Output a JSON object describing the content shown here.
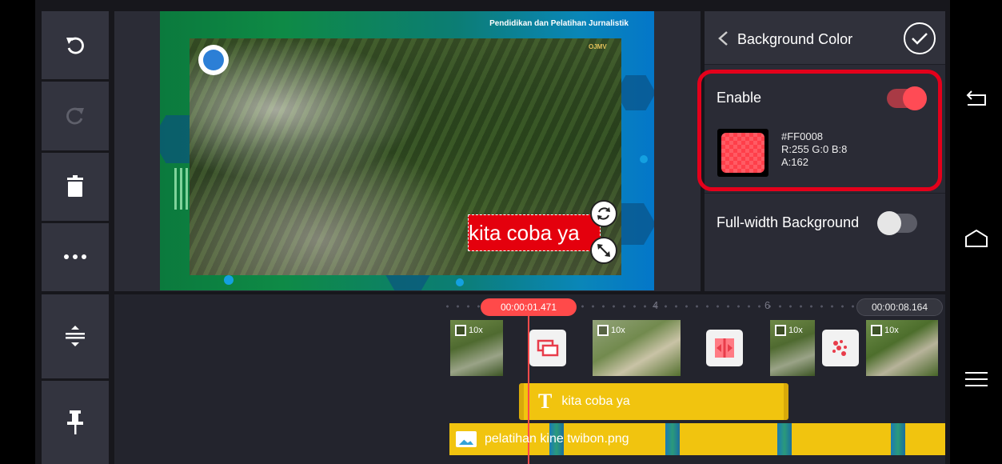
{
  "colors": {
    "accent": "#FF4A4A",
    "panel": "#2A2B35",
    "text_layer": "#F1C40F",
    "annotation": "#E4001B"
  },
  "left_toolbar": {
    "items": [
      "undo-icon",
      "redo-icon",
      "trash-icon",
      "more-icon"
    ],
    "bottom_items": [
      "timeline-expand-icon",
      "pin-icon"
    ]
  },
  "preview": {
    "header_text": "Pendidikan dan Pelatihan Jurnalistik",
    "logo_text": "OJMV",
    "overlay_text": "kita coba ya"
  },
  "panel": {
    "title": "Background Color",
    "enable_label": "Enable",
    "enable_on": true,
    "color_hex": "#FF0008",
    "color_rgb": "R:255 G:0 B:8",
    "color_alpha": "A:162",
    "full_width_label": "Full-width Background",
    "full_width_on": false
  },
  "timeline": {
    "current_time": "00:00:01.471",
    "total_time": "00:00:08.164",
    "ruler_marks": [
      "4",
      "6"
    ],
    "clips": [
      {
        "speed": "10x"
      },
      {
        "speed": "10x"
      },
      {
        "speed": "10x"
      },
      {
        "speed": "10x"
      }
    ],
    "transition_icons": [
      "overlap-transition-icon",
      "split-transition-icon",
      "sparkle-transition-icon"
    ],
    "text_layer_label": "kita coba ya",
    "text_layer_icon": "T",
    "image_layer_label": "pelatihan kine twibon.png"
  },
  "nav": {
    "items": [
      "back-icon",
      "home-icon",
      "menu-icon"
    ]
  }
}
